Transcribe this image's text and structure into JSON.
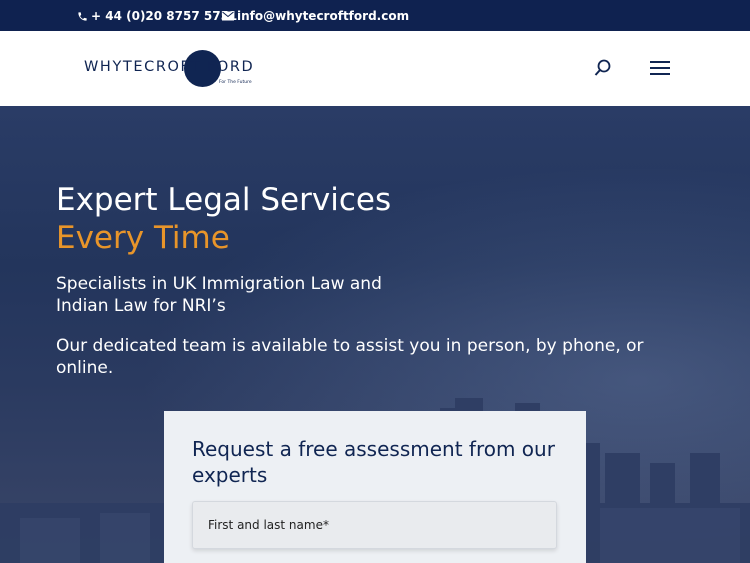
{
  "topbar": {
    "phone": "+ 44 (0)20 8757 5751",
    "email": "info@whytecroftford.com",
    "phone_icon": "phone-icon",
    "email_icon": "envelope-icon"
  },
  "header": {
    "logo": {
      "text": "WHYTECROFT FORD",
      "tagline": "For The Future"
    },
    "search_icon": "search-icon",
    "menu_icon": "hamburger-menu-icon"
  },
  "hero": {
    "title": "Expert Legal Services",
    "accent": "Every Time",
    "subtitle": "Specialists in UK Immigration Law and Indian Law for NRI’s",
    "description": "Our dedicated team is available to assist you in person, by phone, or online."
  },
  "form": {
    "title": "Request a free assessment from our experts",
    "name_placeholder": "First and last name*"
  },
  "colors": {
    "topbar_bg": "#0f2250",
    "brand_navy": "#102552",
    "accent_orange": "#e8952a"
  }
}
